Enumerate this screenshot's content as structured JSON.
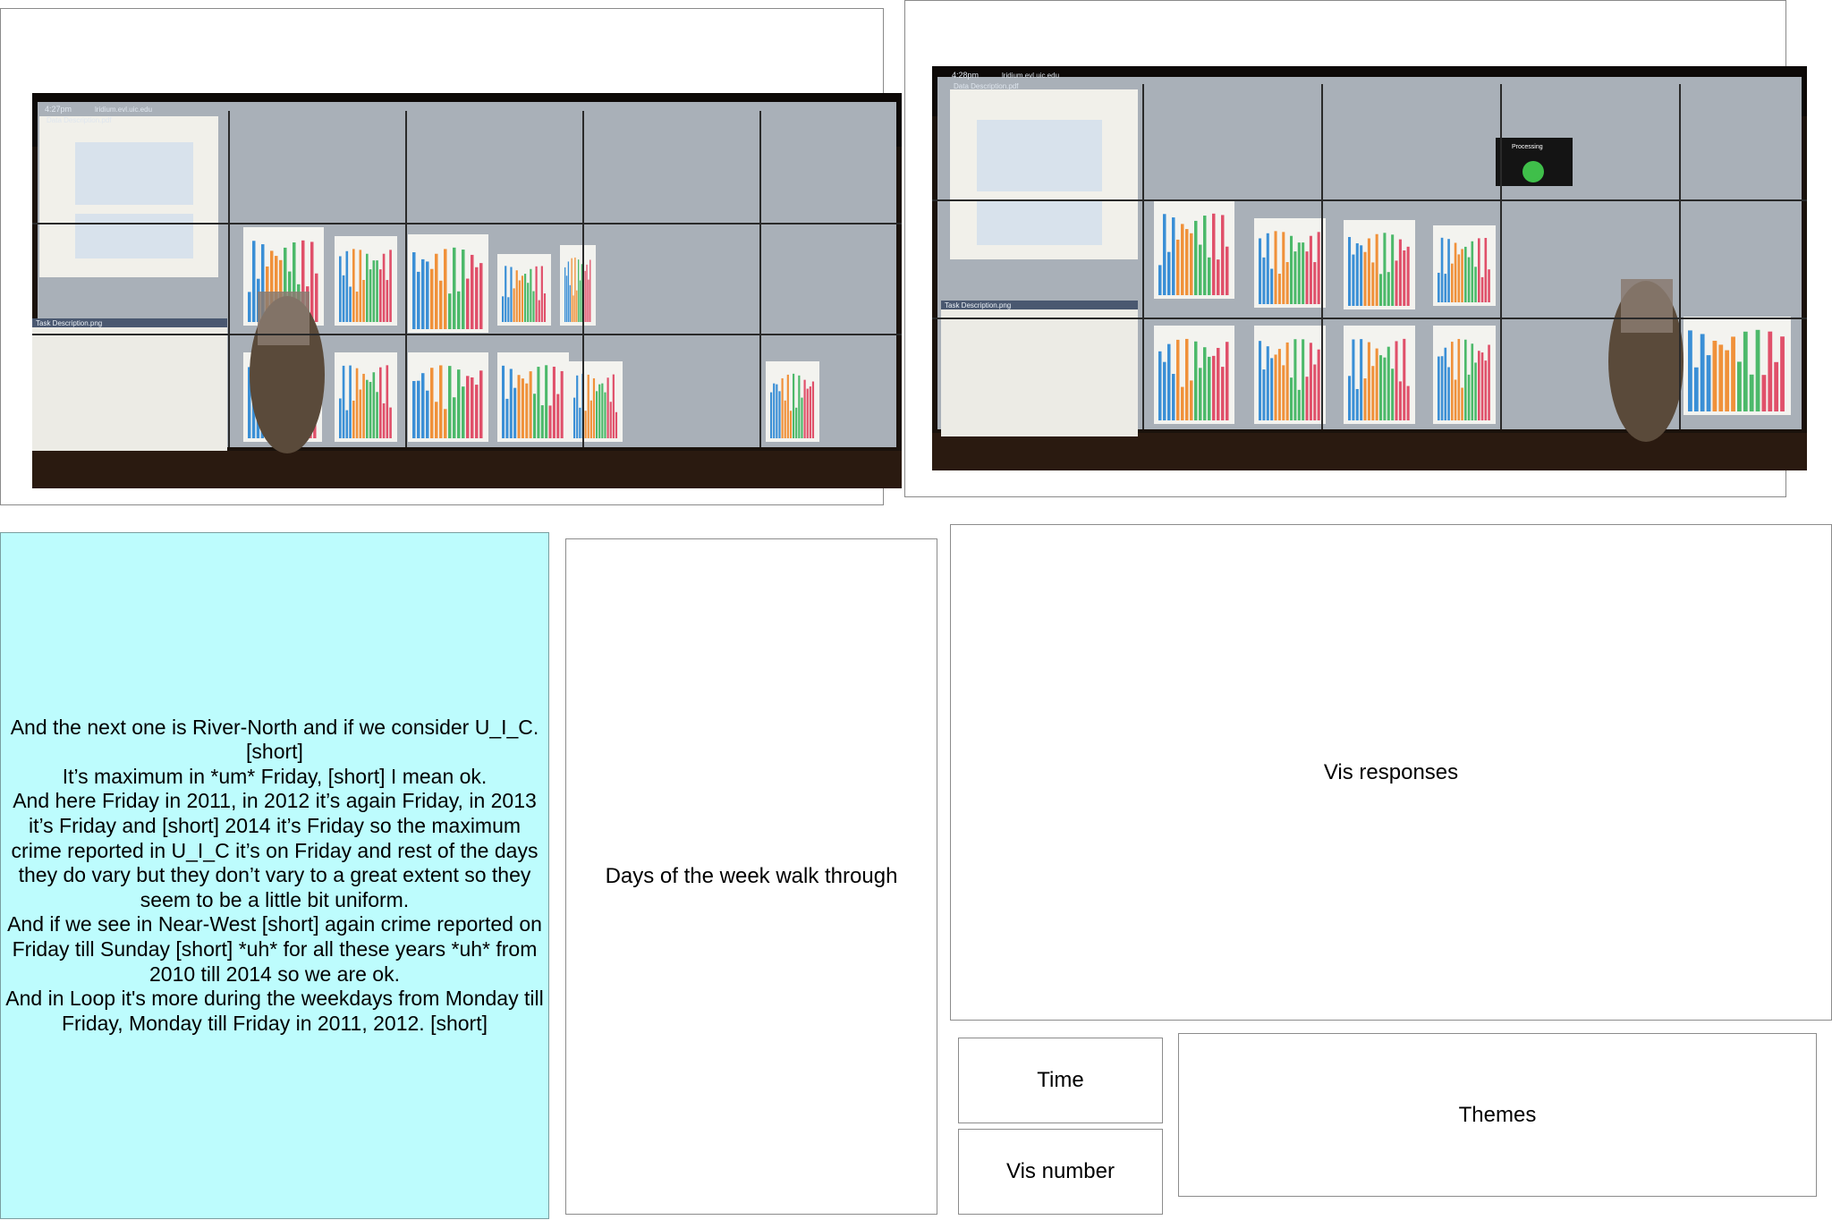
{
  "transcript": {
    "lines": [
      "And the next one is River-North and if we consider U_I_C. [short]",
      "It’s maximum in *um* Friday, [short] I mean ok.",
      "And here Friday in 2011, in 2012 it’s again Friday, in 2013 it’s Friday and [short] 2014 it’s Friday so the maximum crime reported in U_I_C it’s on Friday and rest of the days they do vary but they don’t vary to a great extent so they seem to be a little bit uniform.",
      "And if we see in Near-West [short] again crime reported on Friday till Sunday [short] *uh* for all these years *uh* from 2010 till 2014 so we are ok.",
      "And in Loop it's more during the weekdays from Monday till Friday, Monday till Friday in 2011, 2012. [short]"
    ]
  },
  "labels": {
    "walkthrough": "Days of the week walk through",
    "vis_responses": "Vis responses",
    "time": "Time",
    "vis_number": "Vis number",
    "themes": "Themes"
  },
  "photos": {
    "left": {
      "clock": "4:27pm",
      "host": "lridium.evl.uic.edu",
      "doc_title": "Data Description.pdf",
      "task_title": "Task Description.png"
    },
    "right": {
      "clock": "4:28pm",
      "host": "lridium.evl.uic.edu",
      "doc_title": "Data Description.pdf",
      "task_title": "Task Description.png",
      "status": "Processing"
    }
  },
  "colors": {
    "transcript_bg": "#bdfcfd",
    "bar_blue": "#3a8fd6",
    "bar_orange": "#f0913a",
    "bar_green": "#4cb96a",
    "bar_red": "#e0506a"
  }
}
